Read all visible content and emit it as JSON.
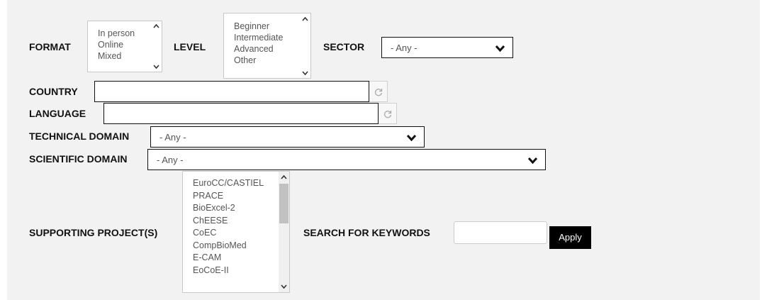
{
  "filters": {
    "format": {
      "label": "FORMAT",
      "options": [
        "In person",
        "Online",
        "Mixed"
      ]
    },
    "level": {
      "label": "LEVEL",
      "options": [
        "Beginner",
        "Intermediate",
        "Advanced",
        "Other"
      ]
    },
    "sector": {
      "label": "SECTOR",
      "value": "- Any -"
    },
    "country": {
      "label": "COUNTRY",
      "value": ""
    },
    "language": {
      "label": "LANGUAGE",
      "value": ""
    },
    "technical_domain": {
      "label": "TECHNICAL DOMAIN",
      "value": "- Any -"
    },
    "scientific_domain": {
      "label": "SCIENTIFIC DOMAIN",
      "value": "- Any -"
    },
    "supporting_projects": {
      "label": "SUPPORTING PROJECT(S)",
      "options": [
        "EuroCC/CASTIEL",
        "PRACE",
        "BioExcel-2",
        "ChEESE",
        "CoEC",
        "CompBioMed",
        "E-CAM",
        "EoCoE-II"
      ]
    },
    "keywords": {
      "label": "SEARCH FOR KEYWORDS",
      "value": ""
    }
  },
  "apply_label": "Apply",
  "icons": {
    "refresh": "refresh-icon",
    "chevron": "chevron-down-icon",
    "scroll_up": "scroll-up-arrow-icon",
    "scroll_down": "scroll-down-arrow-icon"
  }
}
